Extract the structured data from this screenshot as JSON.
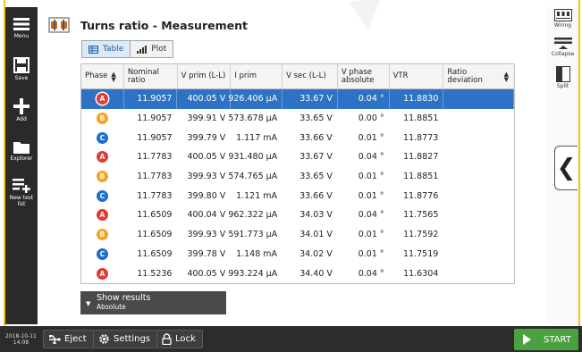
{
  "colors": {
    "phase_A": "#e53935",
    "phase_B": "#f7a21b",
    "phase_C": "#1e6ed0",
    "selected_row": "#2d72c4",
    "start": "#4aa140",
    "frame": "#f2c21a"
  },
  "sidebar": {
    "items": [
      {
        "label": "Menu",
        "icon": "menu-icon"
      },
      {
        "label": "Save",
        "icon": "save-icon"
      },
      {
        "label": "Add",
        "icon": "plus-icon"
      },
      {
        "label": "Explorer",
        "icon": "folder-icon"
      },
      {
        "label": "New test list",
        "icon": "new-test-list-icon"
      }
    ]
  },
  "header": {
    "title": "Turns ratio - Measurement"
  },
  "view_tabs": [
    {
      "label": "Table",
      "selected": true
    },
    {
      "label": "Plot",
      "selected": false
    }
  ],
  "table": {
    "columns": [
      {
        "label": "Phase",
        "sortable": true
      },
      {
        "label": "Nominal ratio",
        "sortable": false
      },
      {
        "label": "V prim (L-L)",
        "sortable": false
      },
      {
        "label": "I prim",
        "sortable": false
      },
      {
        "label": "V sec (L-L)",
        "sortable": false
      },
      {
        "label": "V phase absolute",
        "sortable": false
      },
      {
        "label": "VTR",
        "sortable": false
      },
      {
        "label": "Ratio deviation",
        "sortable": true
      }
    ],
    "rows": [
      {
        "phase": "A",
        "nominal": "11.9057",
        "vprim": "400.05 V",
        "iprim": "926.406 µA",
        "vsec": "33.67 V",
        "vphase": "0.04 °",
        "vtr": "11.8830",
        "dev": "",
        "selected": true
      },
      {
        "phase": "B",
        "nominal": "11.9057",
        "vprim": "399.91 V",
        "iprim": "573.678 µA",
        "vsec": "33.65 V",
        "vphase": "0.00 °",
        "vtr": "11.8851",
        "dev": ""
      },
      {
        "phase": "C",
        "nominal": "11.9057",
        "vprim": "399.79 V",
        "iprim": "1.117 mA",
        "vsec": "33.66 V",
        "vphase": "0.01 °",
        "vtr": "11.8773",
        "dev": ""
      },
      {
        "phase": "A",
        "nominal": "11.7783",
        "vprim": "400.05 V",
        "iprim": "931.480 µA",
        "vsec": "33.67 V",
        "vphase": "0.04 °",
        "vtr": "11.8827",
        "dev": ""
      },
      {
        "phase": "B",
        "nominal": "11.7783",
        "vprim": "399.93 V",
        "iprim": "574.765 µA",
        "vsec": "33.65 V",
        "vphase": "0.01 °",
        "vtr": "11.8851",
        "dev": ""
      },
      {
        "phase": "C",
        "nominal": "11.7783",
        "vprim": "399.80 V",
        "iprim": "1.121 mA",
        "vsec": "33.66 V",
        "vphase": "0.01 °",
        "vtr": "11.8776",
        "dev": ""
      },
      {
        "phase": "A",
        "nominal": "11.6509",
        "vprim": "400.04 V",
        "iprim": "962.322 µA",
        "vsec": "34.03 V",
        "vphase": "0.04 °",
        "vtr": "11.7565",
        "dev": ""
      },
      {
        "phase": "B",
        "nominal": "11.6509",
        "vprim": "399.93 V",
        "iprim": "591.773 µA",
        "vsec": "34.01 V",
        "vphase": "0.01 °",
        "vtr": "11.7592",
        "dev": ""
      },
      {
        "phase": "C",
        "nominal": "11.6509",
        "vprim": "399.78 V",
        "iprim": "1.148 mA",
        "vsec": "34.02 V",
        "vphase": "0.01 °",
        "vtr": "11.7519",
        "dev": ""
      },
      {
        "phase": "A",
        "nominal": "11.5236",
        "vprim": "400.05 V",
        "iprim": "993.224 µA",
        "vsec": "34.40 V",
        "vphase": "0.04 °",
        "vtr": "11.6304",
        "dev": ""
      }
    ]
  },
  "results": {
    "label": "Show results",
    "sub": "Absolute"
  },
  "right_toolbar": [
    {
      "label": "Wiring",
      "icon": "wiring-icon"
    },
    {
      "label": "Collapse",
      "icon": "collapse-icon"
    },
    {
      "label": "Split",
      "icon": "split-icon"
    }
  ],
  "bottom": {
    "date": "2018-10-11",
    "time": "14:08",
    "eject": "Eject",
    "settings": "Settings",
    "lock": "Lock",
    "start": "START"
  }
}
